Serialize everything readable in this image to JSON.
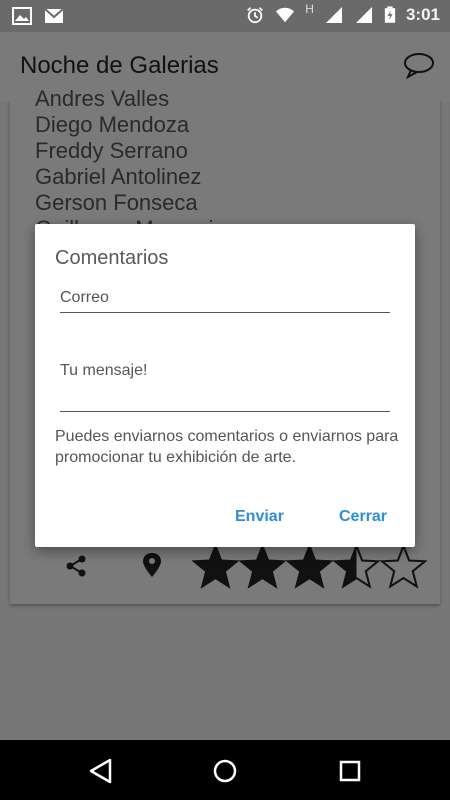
{
  "status_bar": {
    "time": "3:01",
    "network_label": "H",
    "icons": [
      "image-icon",
      "mail-icon",
      "alarm-icon",
      "wifi-icon",
      "signal-icon",
      "signal-icon",
      "battery-charging-icon"
    ]
  },
  "app_bar": {
    "title": "Noche de Galerias",
    "action_icon": "chat-bubble-icon"
  },
  "card": {
    "names": [
      "Andres Valles",
      "Diego Mendoza",
      "Freddy Serrano",
      "Gabriel Antolinez",
      "Gerson Fonseca",
      "Guillermo Marconi"
    ],
    "rating": 3.5,
    "rating_max": 5
  },
  "dialog": {
    "title": "Comentarios",
    "email_placeholder": "Correo",
    "message_placeholder": "Tu mensaje!",
    "help_text": "Puedes enviarnos comentarios o enviarnos para promocionar tu exhibición de arte.",
    "send_label": "Enviar",
    "close_label": "Cerrar",
    "accent_color": "#2a8fd8"
  },
  "nav_bar": {
    "icons": [
      "back-icon",
      "home-icon",
      "recents-icon"
    ]
  }
}
